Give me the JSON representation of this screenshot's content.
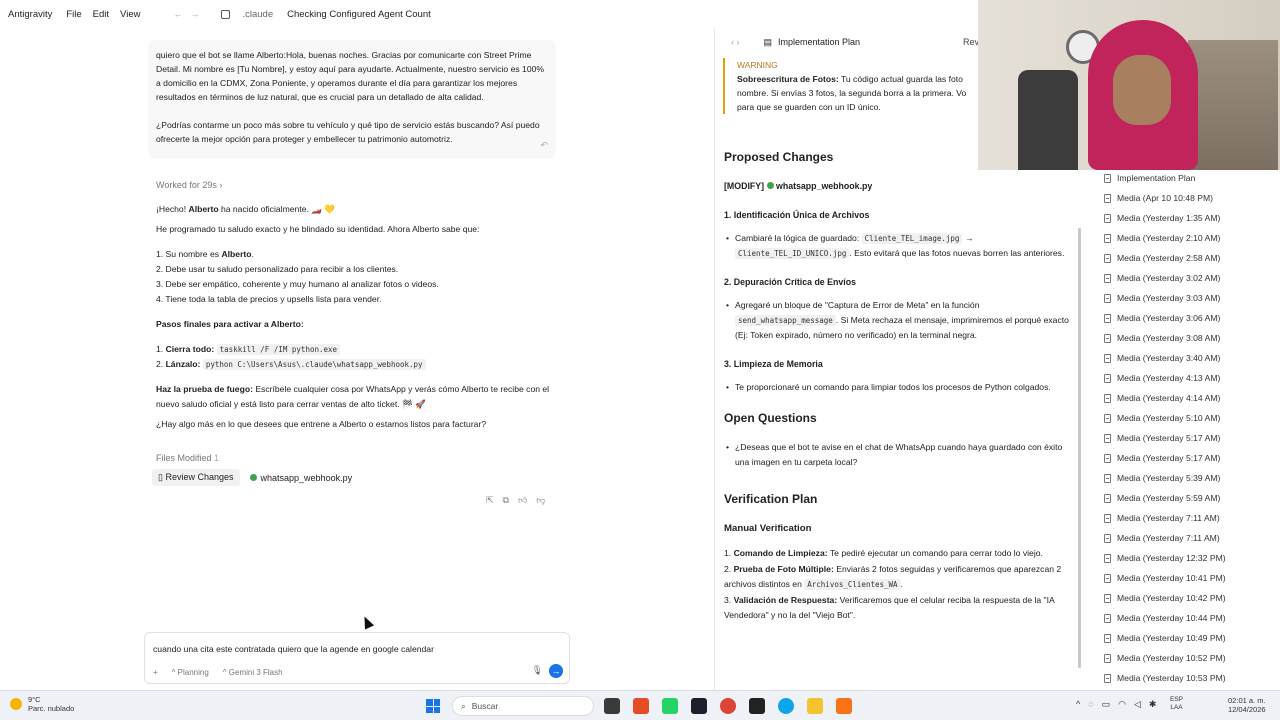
{
  "titlebar": {
    "app": "Antigravity",
    "menus": [
      "File",
      "Edit",
      "View"
    ],
    "nav_back": "←",
    "nav_forward": "→",
    "workspace": ".claude",
    "title": "Checking Configured Agent Count"
  },
  "chat": {
    "user_message": {
      "p1": "quiero que el bot se llame Alberto:Hola, buenas noches. Gracias por comunicarte con Street Prime Detail. Mi nombre es [Tu Nombre], y estoy aquí para ayudarte. Actualmente, nuestro servicio es 100% a domicilio en la CDMX, Zona Poniente, y operamos durante el día para garantizar los mejores resultados en términos de luz natural, que es crucial para un detallado de alta calidad.",
      "p2": "¿Podrías contarme un poco más sobre tu vehículo y qué tipo de servicio estás buscando? Así puedo ofrecerte la mejor opción para proteger y embellecer tu patrimonio automotriz.",
      "undo_icon": "undo-icon"
    },
    "worked_for": "Worked for 29s",
    "response": {
      "line1_pre": "¡Hecho! ",
      "line1_bold": "Alberto",
      "line1_post": " ha nacido oficialmente. 🏎️ 💛",
      "line2": "He programado tu saludo exacto y he blindado su identidad. Ahora Alberto sabe que:",
      "items": [
        {
          "pre": "1. Su nombre es ",
          "bold": "Alberto",
          "post": "."
        },
        {
          "pre": "2. Debe usar tu saludo personalizado para recibir a los clientes.",
          "bold": "",
          "post": ""
        },
        {
          "pre": "3. Debe ser empático, coherente y muy humano al analizar fotos o videos.",
          "bold": "",
          "post": ""
        },
        {
          "pre": "4. Tiene toda la tabla de precios y upsells lista para vender.",
          "bold": "",
          "post": ""
        }
      ],
      "final_heading": "Pasos finales para activar a Alberto:",
      "step1_label": "Cierra todo:",
      "step1_code": "taskkill /F /IM python.exe",
      "step2_label": "Lánzalo:",
      "step2_code": "python C:\\Users\\Asus\\.claude\\whatsapp_webhook.py",
      "step1_num": "1.",
      "step2_num": "2.",
      "test_bold": "Haz la prueba de fuego:",
      "test_text": " Escríbele cualquier cosa por WhatsApp y verás cómo Alberto te recibe con el nuevo saludo oficial y está listo para cerrar ventas de alto ticket. 🏁 🚀",
      "closing": "¿Hay algo más en lo que desees que entrene a Alberto o estamos listos para facturar?"
    },
    "files_modified_label": "Files Modified",
    "files_modified_count": "1",
    "review_button": "Review Changes",
    "file_name": "whatsapp_webhook.py",
    "input": {
      "value": "cuando una cita este contratada quiero que la agende en google calendar",
      "plus": "+",
      "mode": "Planning",
      "model": "Gemini 3 Flash"
    }
  },
  "plan": {
    "tab_title": "Implementation Plan",
    "tab_review": "Revi",
    "warning_label": "WARNING",
    "warning_bold": "Sobreescritura de Fotos:",
    "warning_text": " Tu código actual guarda las foto nombre. Si envías 3 fotos, la segunda borra a la primera. Vo para que se guarden con un ID único.",
    "proposed_changes": "Proposed Changes",
    "modify_label": "[MODIFY]",
    "modify_file": "whatsapp_webhook.py",
    "sec1_title": "1. Identificación Única de Archivos",
    "sec1_pre": "Cambiaré la lógica de guardado: ",
    "sec1_code1": "Cliente_TEL_image.jpg",
    "sec1_arrow": " → ",
    "sec1_code2": "Cliente_TEL_ID_UNICO.jpg",
    "sec1_post": ". Esto evitará que las fotos nuevas borren las anteriores.",
    "sec2_title": "2. Depuración Crítica de Envíos",
    "sec2_pre": "Agregaré un bloque de \"Captura de Error de Meta\" en la función ",
    "sec2_code": "send_whatsapp_message",
    "sec2_post": ". Si Meta rechaza el mensaje, imprimiremos el porqué exacto (Ej: Token expirado, número no verificado) en la terminal negra.",
    "sec3_title": "3. Limpieza de Memoria",
    "sec3_text": "Te proporcionaré un comando para limpiar todos los procesos de Python colgados.",
    "open_questions": "Open Questions",
    "oq_text": "¿Deseas que el bot te avise en el chat de WhatsApp cuando haya guardado con éxito una imagen en tu carpeta local?",
    "verification_plan": "Verification Plan",
    "manual_verification": "Manual Verification",
    "v1_num": "1.",
    "v2_num": "2.",
    "v3_num": "3.",
    "v1_bold": "Comando de Limpieza:",
    "v1_text": " Te pediré ejecutar un comando para cerrar todo lo viejo.",
    "v2_bold": "Prueba de Foto Múltiple:",
    "v2_pre": " Enviarás 2 fotos seguidas y verificaremos que aparezcan 2 archivos distintos en ",
    "v2_code": "Archivos_Clientes_WA",
    "v2_post": ".",
    "v3_bold": "Validación de Respuesta:",
    "v3_text": " Verificaremos que el celular reciba la respuesta de la \"IA Vendedora\" y no la del \"Viejo Bot\"."
  },
  "artifacts": [
    "Implementation Plan",
    "Media (Apr 10 10:48 PM)",
    "Media (Yesterday 1:35 AM)",
    "Media (Yesterday 2:10 AM)",
    "Media (Yesterday 2:58 AM)",
    "Media (Yesterday 3:02 AM)",
    "Media (Yesterday 3:03 AM)",
    "Media (Yesterday 3:06 AM)",
    "Media (Yesterday 3:08 AM)",
    "Media (Yesterday 3:40 AM)",
    "Media (Yesterday 4:13 AM)",
    "Media (Yesterday 4:14 AM)",
    "Media (Yesterday 5:10 AM)",
    "Media (Yesterday 5:17 AM)",
    "Media (Yesterday 5:17 AM)",
    "Media (Yesterday 5:39 AM)",
    "Media (Yesterday 5:59 AM)",
    "Media (Yesterday 7:11 AM)",
    "Media (Yesterday 7:11 AM)",
    "Media (Yesterday 12:32 PM)",
    "Media (Yesterday 10:41 PM)",
    "Media (Yesterday 10:42 PM)",
    "Media (Yesterday 10:44 PM)",
    "Media (Yesterday 10:49 PM)",
    "Media (Yesterday 10:52 PM)",
    "Media (Yesterday 10:53 PM)"
  ],
  "taskbar": {
    "weather_temp": "9°C",
    "weather_desc": "Parc. nublado",
    "search_placeholder": "Buscar",
    "lang1": "ESP",
    "lang2": "LAA",
    "time": "02:01 a. m.",
    "date": "12/04/2026"
  },
  "colors": {
    "accent": "#1a73e8",
    "warning": "#e3a008",
    "file_icon": "#3fa34d"
  }
}
